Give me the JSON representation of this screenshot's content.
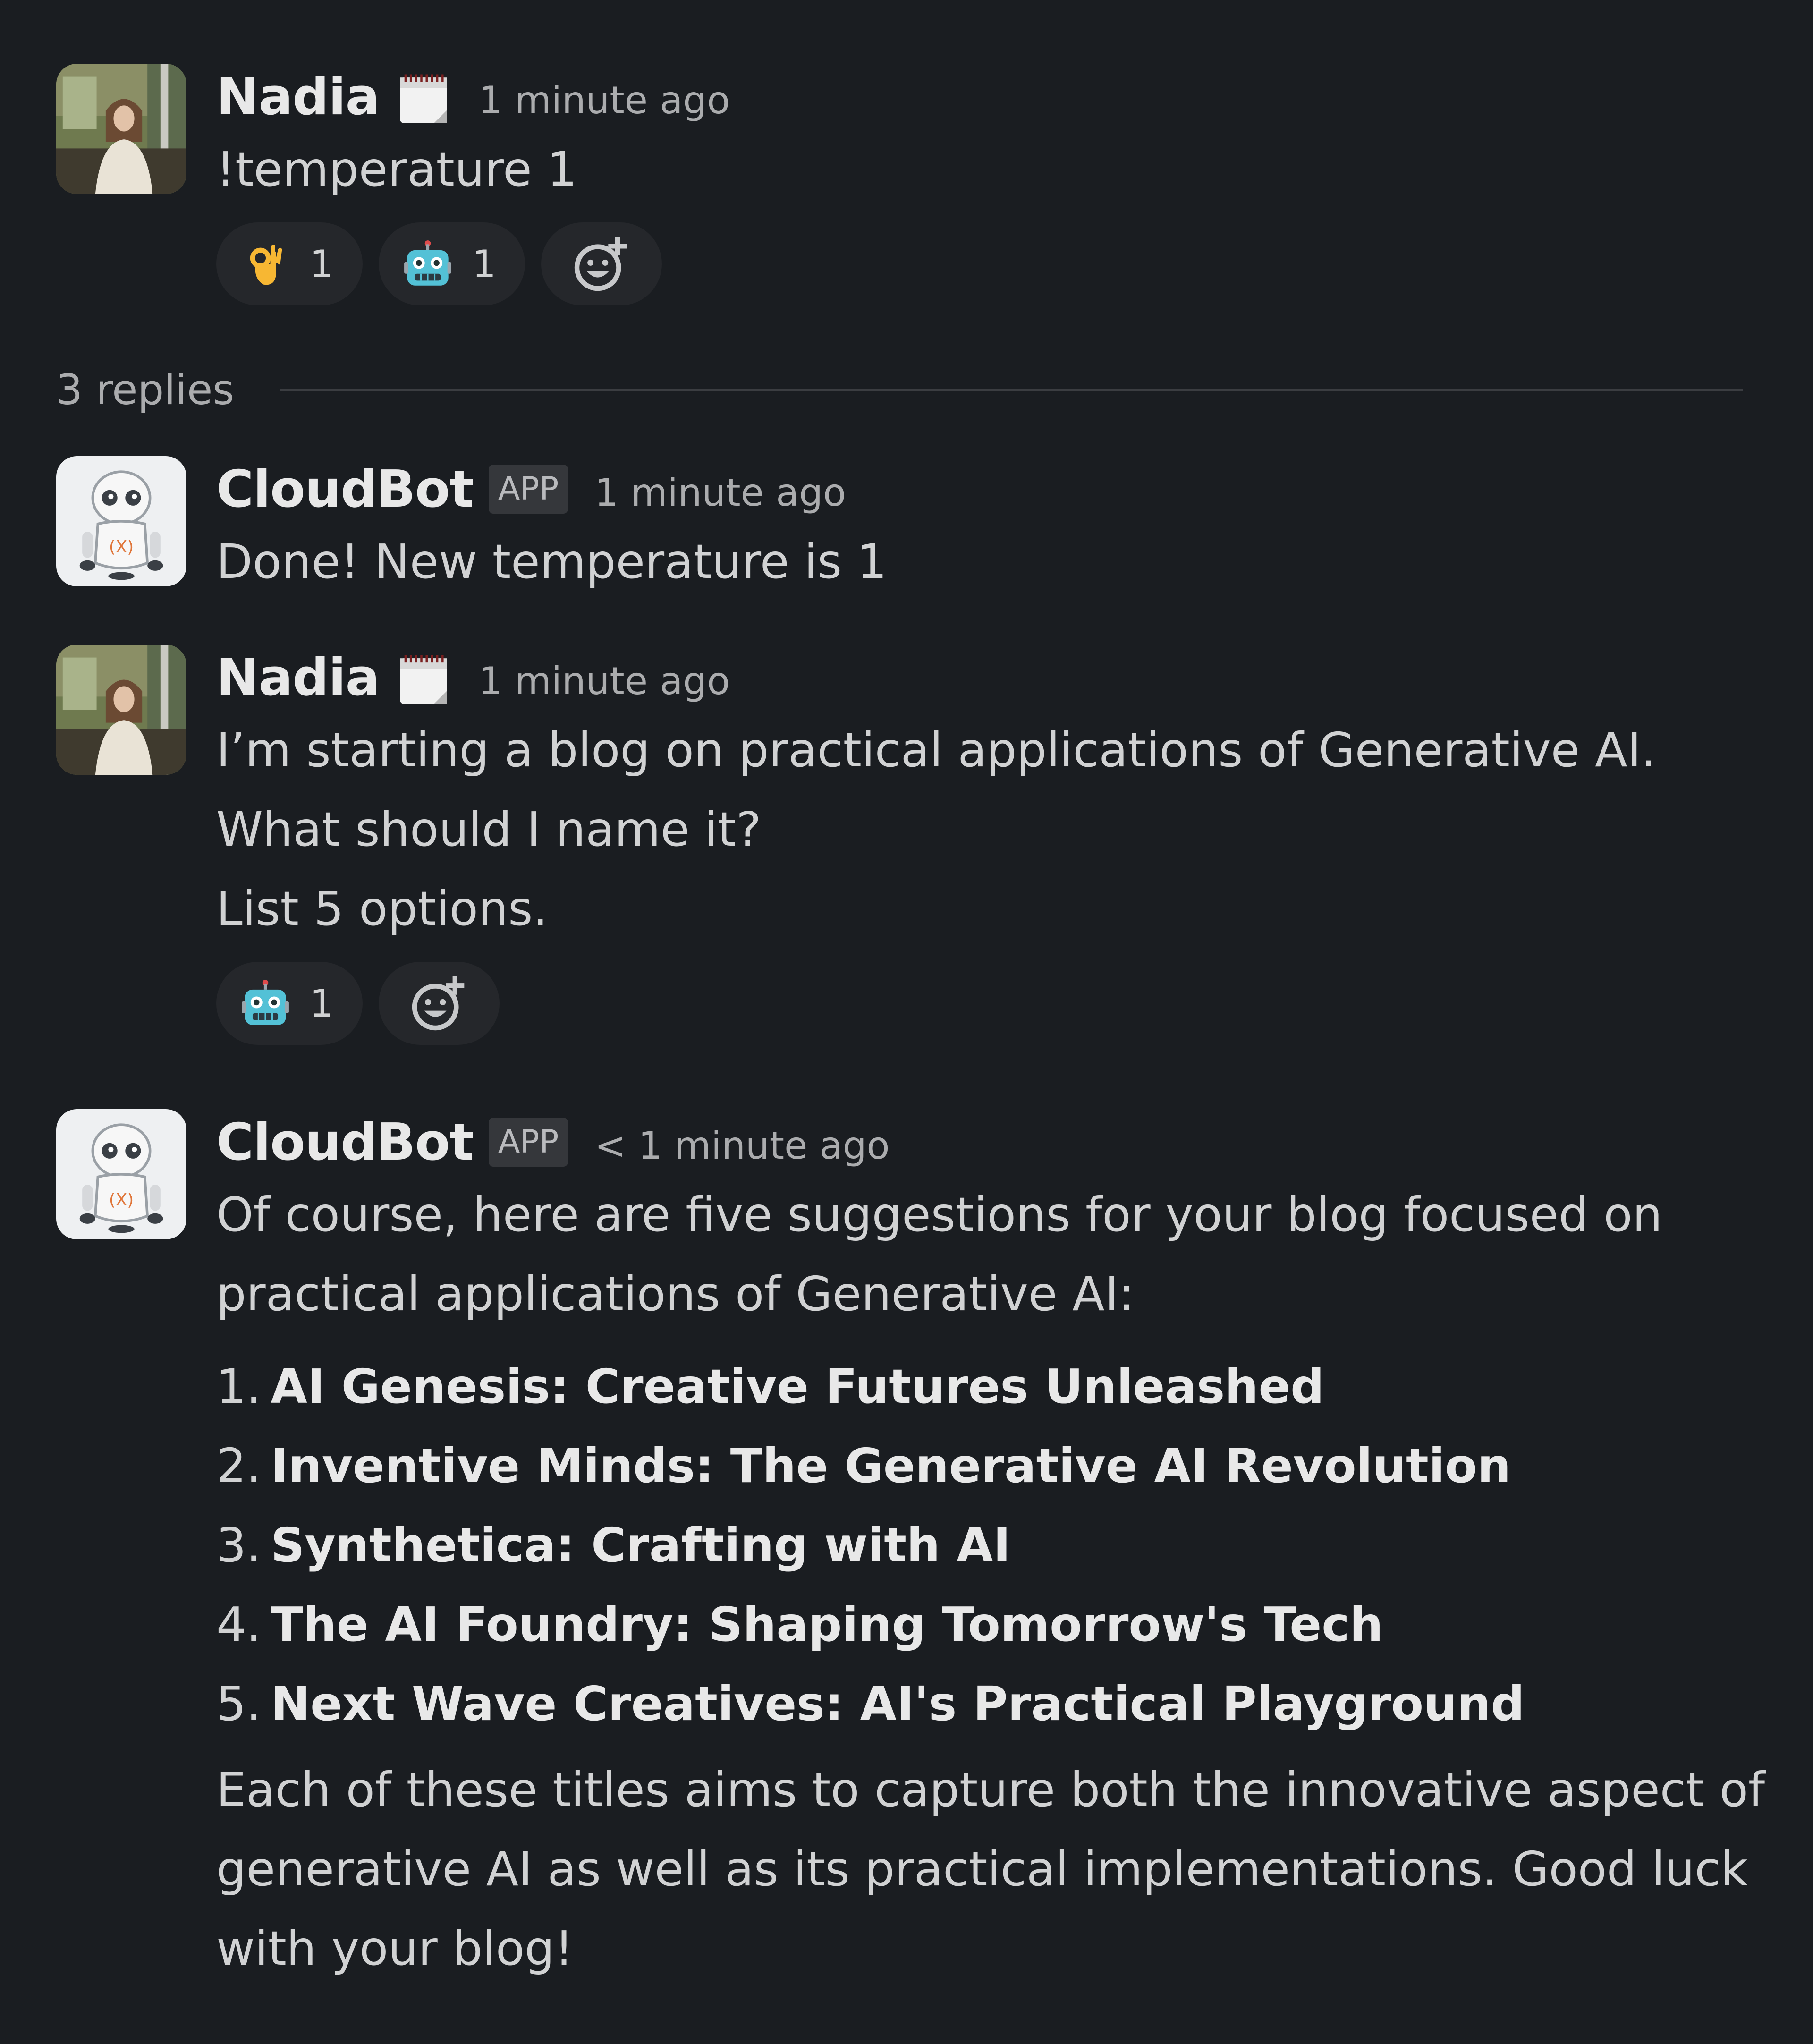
{
  "thread": {
    "replies_label": "3 replies"
  },
  "messages": [
    {
      "author": "Nadia",
      "timestamp": "1 minute ago",
      "text": "!temperature 1",
      "reactions": [
        {
          "emoji": "ok-hand-emoji",
          "count": "1"
        },
        {
          "emoji": "robot-emoji",
          "count": "1"
        }
      ]
    },
    {
      "author": "CloudBot",
      "badge": "APP",
      "timestamp": "1 minute ago",
      "text": "Done! New temperature is 1"
    },
    {
      "author": "Nadia",
      "timestamp": "1 minute ago",
      "lines": [
        "I’m starting a blog on practical applications of Generative AI.",
        "What should I name it?",
        "List 5 options."
      ],
      "reactions": [
        {
          "emoji": "robot-emoji",
          "count": "1"
        }
      ]
    },
    {
      "author": "CloudBot",
      "badge": "APP",
      "timestamp": "< 1 minute ago",
      "intro": "Of course, here are five suggestions for your blog focused on practical applications of Generative AI:",
      "options": [
        {
          "num": "1.",
          "title": "AI Genesis: Creative Futures Unleashed"
        },
        {
          "num": "2.",
          "title": "Inventive Minds: The Generative AI Revolution"
        },
        {
          "num": "3.",
          "title": "Synthetica: Crafting with AI"
        },
        {
          "num": "4.",
          "title": "The AI Foundry: Shaping Tomorrow's Tech"
        },
        {
          "num": "5.",
          "title": "Next Wave Creatives: AI's Practical Playground"
        }
      ],
      "outro": "Each of these titles aims to capture both the innovative aspect of generative AI as well as its practical implementations. Good luck with your blog!"
    }
  ],
  "icons": {
    "calendar": "calendar-icon",
    "add_reaction": "add-reaction-icon",
    "user_avatar": "nadia-avatar",
    "bot_avatar": "cloudbot-avatar"
  },
  "colors": {
    "background": "#1a1d21",
    "reaction_bg": "#25272b",
    "badge_bg": "#35373b",
    "text": "#d1d2d3",
    "muted": "#abacae"
  }
}
